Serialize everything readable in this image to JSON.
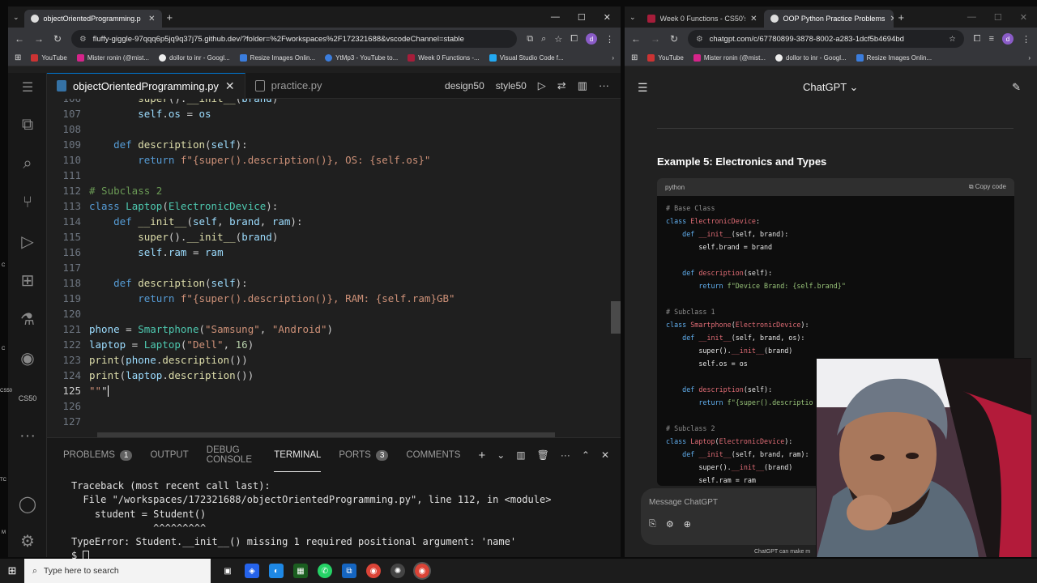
{
  "left_browser": {
    "tabs": [
      {
        "label": "objectOrientedProgramming.p",
        "active": true
      },
      {
        "label": "+"
      }
    ],
    "url": "fluffy-giggle-97qqq6p5jq9q37j75.github.dev/?folder=%2Fworkspaces%2F172321688&vscodeChannel=stable",
    "bookmarks": [
      "YouTube",
      "Mister ronin (@mist...",
      "dollor to inr - Googl...",
      "Resize Images Onlin...",
      "YtMp3 - YouTube to...",
      "Week 0 Functions -...",
      "Visual Studio Code f..."
    ]
  },
  "right_browser": {
    "tabs": [
      {
        "label": "Week 0 Functions - CS50's Intr",
        "active": false
      },
      {
        "label": "OOP Python Practice Problems",
        "active": true
      },
      {
        "label": "+"
      }
    ],
    "url": "chatgpt.com/c/67780899-3878-8002-a283-1dcf5b4694bd",
    "bookmarks": [
      "YouTube",
      "Mister ronin (@mist...",
      "dollor to inr - Googl...",
      "Resize Images Onlin..."
    ],
    "chatgpt": {
      "title": "ChatGPT ⌄",
      "heading": "Example 5: Electronics and Types",
      "code_lang": "python",
      "copy_label": "Copy code",
      "message_placeholder": "Message ChatGPT",
      "footer": "ChatGPT can make m"
    }
  },
  "editor": {
    "tabs": [
      {
        "label": "objectOrientedProgramming.py",
        "active": true
      },
      {
        "label": "practice.py",
        "active": false
      }
    ],
    "toolbar": {
      "design": "design50",
      "style": "style50"
    },
    "line_numbers": [
      "106",
      "107",
      "108",
      "109",
      "110",
      "111",
      "112",
      "113",
      "114",
      "115",
      "116",
      "117",
      "118",
      "119",
      "120",
      "121",
      "122",
      "123",
      "124",
      "125",
      "126",
      "127"
    ],
    "lines": [
      "        super().__init__(brand)",
      "        self.os = os",
      "",
      "    def description(self):",
      "        return f\"{super().description()}, OS: {self.os}\"",
      "",
      "# Subclass 2",
      "class Laptop(ElectronicDevice):",
      "    def __init__(self, brand, ram):",
      "        super().__init__(brand)",
      "        self.ram = ram",
      "",
      "    def description(self):",
      "        return f\"{super().description()}, RAM: {self.ram}GB\"",
      "",
      "phone = Smartphone(\"Samsung\", \"Android\")",
      "laptop = Laptop(\"Dell\", 16)",
      "print(phone.description())",
      "print(laptop.description())",
      "\"\"\"",
      "",
      ""
    ]
  },
  "panel": {
    "tabs": [
      {
        "label": "PROBLEMS",
        "badge": "1"
      },
      {
        "label": "OUTPUT"
      },
      {
        "label": "DEBUG CONSOLE"
      },
      {
        "label": "TERMINAL",
        "active": true
      },
      {
        "label": "PORTS",
        "badge": "3"
      },
      {
        "label": "COMMENTS"
      }
    ],
    "terminal": [
      "Traceback (most recent call last):",
      "  File \"/workspaces/172321688/objectOrientedProgramming.py\", line 112, in <module>",
      "    student = Student()",
      "              ^^^^^^^^^",
      "TypeError: Student.__init__() missing 1 required positional argument: 'name'",
      "$ "
    ]
  },
  "gpt_code": [
    "# Base Class",
    "class ElectronicDevice:",
    "    def __init__(self, brand):",
    "        self.brand = brand",
    "",
    "    def description(self):",
    "        return f\"Device Brand: {self.brand}\"",
    "",
    "# Subclass 1",
    "class Smartphone(ElectronicDevice):",
    "    def __init__(self, brand, os):",
    "        super().__init__(brand)",
    "        self.os = os",
    "",
    "    def description(self):",
    "        return f\"{super().descriptio",
    "",
    "# Subclass 2",
    "class Laptop(ElectronicDevice):",
    "    def __init__(self, brand, ram):",
    "        super().__init__(brand)",
    "        self.ram = ram"
  ],
  "taskbar": {
    "search_placeholder": "Type here to search"
  },
  "side_labels": [
    "C",
    "C",
    "CS50",
    "TC",
    "M"
  ]
}
